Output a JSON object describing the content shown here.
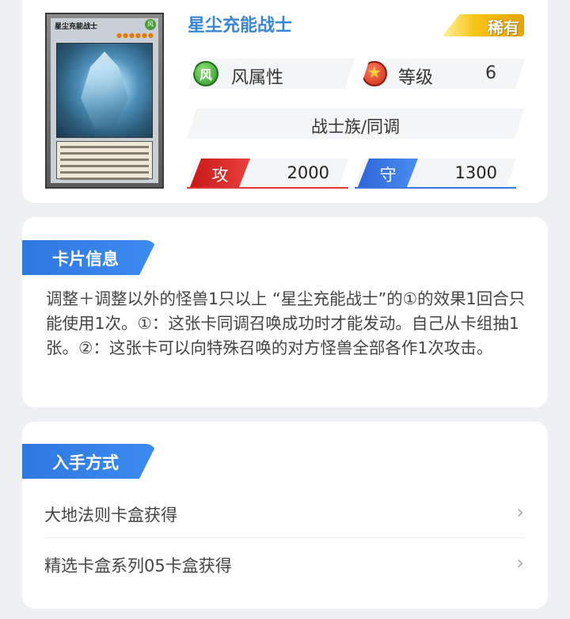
{
  "card": {
    "name": "星尘充能战士",
    "rarity": "稀有",
    "attribute_icon_text": "风",
    "attribute": "风属性",
    "level_label": "等级",
    "level": "6",
    "race": "战士族/同调",
    "atk_label": "攻",
    "atk": "2000",
    "def_label": "守",
    "def": "1300",
    "thumbnail": {
      "name": "星尘充能战士",
      "attr": "风",
      "stars": "●●●●●●"
    }
  },
  "info": {
    "section_title": "卡片信息",
    "description": "调整＋调整以外的怪兽1只以上 “星尘充能战士”的①的效果1回合只能使用1次。①：这张卡同调召唤成功时才能发动。自己从卡组抽1张。②：这张卡可以向特殊召唤的对方怪兽全部各作1次攻击。"
  },
  "obtain": {
    "section_title": "入手方式",
    "items": [
      {
        "label": "大地法则卡盒获得"
      },
      {
        "label": "精选卡盒系列05卡盒获得"
      }
    ]
  },
  "colors": {
    "accent": "#3a86d6",
    "atk": "#e03a3a",
    "def": "#3a7ae0",
    "rarity": "#f6c417"
  },
  "icons": {
    "attribute": "wind-attribute-icon",
    "level": "level-star-icon",
    "row_arrow": "chevron-right-icon"
  }
}
